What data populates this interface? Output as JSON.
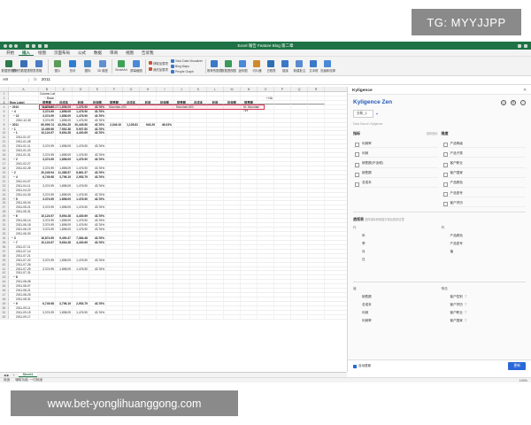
{
  "watermark_top": "TG: MYYJJPP",
  "watermark_bottom": "www.bet-yonglihuanggong.com",
  "window_title": "Excel 報告 Feature Blog 第二章",
  "ribbon": {
    "tabs": [
      "开始",
      "插入",
      "绘图",
      "页面布局",
      "公式",
      "数据",
      "审阅",
      "视图",
      "告诉我"
    ],
    "active_tab": "插入",
    "buttons": [
      {
        "label": "数据透视表",
        "icon": "pivot-table-icon",
        "color": "#2c7a4b"
      },
      {
        "label": "推荐的数据透视表",
        "icon": "recommended-pivot-icon",
        "color": "#3a6fb5"
      },
      {
        "label": "表格",
        "icon": "table-icon",
        "color": "#4a7cc6"
      },
      {
        "label": "图片",
        "icon": "picture-icon",
        "color": "#5a9a5a"
      },
      {
        "label": "形状",
        "icon": "shapes-icon",
        "color": "#2f7dd1"
      },
      {
        "label": "图标",
        "icon": "icons-icon",
        "color": "#4b86c4"
      },
      {
        "label": "3D 模型",
        "icon": "3d-model-icon",
        "color": "#5f8fd0"
      },
      {
        "label": "SmartArt",
        "icon": "smartart-icon",
        "color": "#3fa15a"
      },
      {
        "label": "屏幕截图",
        "icon": "screenshot-icon",
        "color": "#4a88d8"
      }
    ],
    "small_buttons": [
      "获取加载项",
      "我的加载项"
    ],
    "addin_buttons": [
      "Visio Data Visualizer",
      "Bing Maps",
      "People Graph"
    ],
    "right_buttons": [
      "推荐的图表",
      "数据透视图",
      "迷你图",
      "切片器",
      "日程表",
      "链接",
      "新建批注",
      "文本框",
      "页眉和页脚",
      "艺术字",
      "符号",
      "公式"
    ]
  },
  "formula_bar": {
    "cell": "A9",
    "fx": "fx",
    "value": "2011"
  },
  "columns": [
    "A",
    "B",
    "C",
    "D",
    "E",
    "F",
    "G",
    "H",
    "I",
    "J",
    "K",
    "L",
    "M",
    "N",
    "O",
    "P",
    "Q",
    "R"
  ],
  "pivot_header": {
    "row1": "Column Label",
    "row2": "− Black",
    "row3_labels": [
      "Mountain-100",
      "Mountain-200",
      "Mountain-500",
      "HL Mountain Tire"
    ],
    "na": "+ NA",
    "measures": [
      "销售额",
      "总成本",
      "利润",
      "利润率",
      "销售额",
      "总成本",
      "利润",
      "利润率",
      "销售额",
      "总成本",
      "利润",
      "利润率",
      "销售额"
    ]
  },
  "rows": [
    {
      "n": "1",
      "a": "",
      "v": []
    },
    {
      "n": "2",
      "a": "",
      "v": []
    },
    {
      "n": "3",
      "a": "Row Label",
      "v": [],
      "head": true
    },
    {
      "n": "4",
      "a": "− 2010",
      "v": [
        "3,374.99",
        "1,898.09",
        "1,476.90",
        "43.76%"
      ],
      "bold": true,
      "lvl": 0
    },
    {
      "n": "5",
      "a": "− 4",
      "v": [
        "3,374.99",
        "1,898.09",
        "1,476.90",
        "43.76%"
      ],
      "bold": true,
      "lvl": 1
    },
    {
      "n": "6",
      "a": "− 12",
      "v": [
        "3,374.99",
        "1,898.09",
        "1,476.90",
        "43.76%"
      ],
      "bold": true,
      "lvl": 2
    },
    {
      "n": "7",
      "a": "2010-12-30",
      "v": [
        "3,374.99",
        "1,898.09",
        "1,476.90",
        "43.76%"
      ],
      "lvl": 3
    },
    {
      "n": "8",
      "a": "− 2011",
      "v": [
        "60,999.74",
        "43,554.25",
        "20,445.50",
        "43.76%",
        "2,049.10",
        "1,105.81",
        "943.29",
        "46.03%"
      ],
      "bold": true,
      "lvl": 0
    },
    {
      "n": "9",
      "a": "− 1",
      "v": [
        "13,499.96",
        "7,592.36",
        "5,907.60",
        "43.76%"
      ],
      "bold": true,
      "lvl": 1
    },
    {
      "n": "10",
      "a": "− 1",
      "v": [
        "10,124.97",
        "5,694.28",
        "4,430.69",
        "43.76%"
      ],
      "bold": true,
      "lvl": 2
    },
    {
      "n": "11",
      "a": "2011-01-07",
      "v": [],
      "lvl": 3
    },
    {
      "n": "12",
      "a": "2011-01-08",
      "v": [],
      "lvl": 3
    },
    {
      "n": "13",
      "a": "2011-01-11",
      "v": [
        "3,374.99",
        "1,898.09",
        "1,476.90",
        "43.76%"
      ],
      "lvl": 3
    },
    {
      "n": "14",
      "a": "2011-01-20",
      "v": [],
      "lvl": 3
    },
    {
      "n": "15",
      "a": "2011-01-31",
      "v": [
        "3,374.99",
        "1,898.09",
        "1,476.90",
        "43.76%"
      ],
      "lvl": 3
    },
    {
      "n": "16",
      "a": "− 2",
      "v": [
        "3,374.99",
        "1,898.09",
        "1,476.90",
        "43.76%"
      ],
      "bold": true,
      "lvl": 2
    },
    {
      "n": "17",
      "a": "2011-02-27",
      "v": [],
      "lvl": 3
    },
    {
      "n": "18",
      "a": "2011-02-28",
      "v": [
        "3,374.99",
        "1,898.09",
        "1,476.90",
        "43.76%"
      ],
      "lvl": 3
    },
    {
      "n": "19",
      "a": "− 2",
      "v": [
        "20,249.94",
        "11,388.57",
        "8,861.37",
        "43.76%"
      ],
      "bold": true,
      "lvl": 1
    },
    {
      "n": "20",
      "a": "− 4",
      "v": [
        "6,749.98",
        "3,796.19",
        "2,953.79",
        "43.76%"
      ],
      "bold": true,
      "lvl": 2
    },
    {
      "n": "21",
      "a": "2011-04-07",
      "v": [],
      "lvl": 3
    },
    {
      "n": "22",
      "a": "2011-04-11",
      "v": [
        "3,374.99",
        "1,898.09",
        "1,476.90",
        "43.76%"
      ],
      "lvl": 3
    },
    {
      "n": "23",
      "a": "2011-04-22",
      "v": [],
      "lvl": 3
    },
    {
      "n": "24",
      "a": "2011-04-30",
      "v": [
        "3,374.99",
        "1,898.09",
        "1,476.90",
        "43.76%"
      ],
      "lvl": 3
    },
    {
      "n": "25",
      "a": "− 5",
      "v": [
        "3,374.99",
        "1,898.09",
        "1,476.90",
        "43.76%"
      ],
      "bold": true,
      "lvl": 2
    },
    {
      "n": "26",
      "a": "2011-05-04",
      "v": [],
      "lvl": 3
    },
    {
      "n": "27",
      "a": "2011-05-21",
      "v": [
        "3,374.99",
        "1,898.09",
        "1,476.90",
        "43.76%"
      ],
      "lvl": 3
    },
    {
      "n": "28",
      "a": "2011-05-31",
      "v": [],
      "lvl": 3
    },
    {
      "n": "29",
      "a": "− 6",
      "v": [
        "10,124.97",
        "5,694.28",
        "4,430.69",
        "43.76%"
      ],
      "bold": true,
      "lvl": 2
    },
    {
      "n": "30",
      "a": "2011-06-14",
      "v": [
        "3,374.99",
        "1,898.09",
        "1,476.90",
        "43.76%"
      ],
      "lvl": 3
    },
    {
      "n": "31",
      "a": "2011-06-18",
      "v": [
        "3,374.99",
        "1,898.09",
        "1,476.90",
        "43.76%"
      ],
      "lvl": 3
    },
    {
      "n": "32",
      "a": "2011-06-19",
      "v": [
        "3,374.99",
        "1,898.09",
        "1,476.90",
        "43.76%"
      ],
      "lvl": 3
    },
    {
      "n": "33",
      "a": "2011-06-30",
      "v": [],
      "lvl": 3
    },
    {
      "n": "34",
      "a": "− 3",
      "v": [
        "16,874.95",
        "9,490.47",
        "7,384.48",
        "43.76%"
      ],
      "bold": true,
      "lvl": 1
    },
    {
      "n": "35",
      "a": "− 7",
      "v": [
        "10,124.97",
        "5,694.28",
        "4,430.69",
        "43.76%"
      ],
      "bold": true,
      "lvl": 2
    },
    {
      "n": "36",
      "a": "2011-07-11",
      "v": [],
      "lvl": 3
    },
    {
      "n": "37",
      "a": "2011-07-14",
      "v": [],
      "lvl": 3
    },
    {
      "n": "38",
      "a": "2011-07-21",
      "v": [],
      "lvl": 3
    },
    {
      "n": "39",
      "a": "2011-07-22",
      "v": [
        "3,374.99",
        "1,898.09",
        "1,476.90",
        "43.76%"
      ],
      "lvl": 3
    },
    {
      "n": "40",
      "a": "2011-07-26",
      "v": [],
      "lvl": 3
    },
    {
      "n": "41",
      "a": "2011-07-29",
      "v": [
        "3,374.99",
        "1,898.09",
        "1,476.90",
        "43.76%"
      ],
      "lvl": 3
    },
    {
      "n": "42",
      "a": "2011-07-31",
      "v": [],
      "lvl": 3
    },
    {
      "n": "43",
      "a": "− 8",
      "v": [],
      "bold": true,
      "lvl": 2
    },
    {
      "n": "44",
      "a": "2011-08-08",
      "v": [],
      "lvl": 3
    },
    {
      "n": "45",
      "a": "2011-08-07",
      "v": [],
      "lvl": 3
    },
    {
      "n": "46",
      "a": "2011-08-21",
      "v": [],
      "lvl": 3
    },
    {
      "n": "47",
      "a": "2011-08-25",
      "v": [],
      "lvl": 3
    },
    {
      "n": "48",
      "a": "2011-08-31",
      "v": [],
      "lvl": 3
    },
    {
      "n": "49",
      "a": "− 9",
      "v": [
        "6,749.98",
        "3,796.19",
        "2,953.79",
        "43.76%"
      ],
      "bold": true,
      "lvl": 2
    },
    {
      "n": "50",
      "a": "2011-09-11",
      "v": [],
      "lvl": 3
    },
    {
      "n": "51",
      "a": "2011-09-15",
      "v": [
        "3,374.99",
        "1,898.09",
        "1,476.90",
        "43.76%"
      ],
      "lvl": 3
    },
    {
      "n": "52",
      "a": "2011-09-17",
      "v": [],
      "lvl": 3
    }
  ],
  "sheet_tabs": {
    "add": "+",
    "nav": "◀ ▶",
    "active": "Sheet1"
  },
  "statusbar": {
    "left": [
      "就绪",
      "辅助功能: 一切就绪"
    ],
    "zoom": "100%"
  },
  "panel": {
    "title": "Kyligence",
    "close": "✕",
    "brand": "Kyligence Zen",
    "icons": [
      "◎",
      "☰",
      "i"
    ],
    "analysis_tab": "分析_1",
    "add": "+",
    "subtitle": "Data Source: Kyligence",
    "metrics_title": "指标",
    "metrics_hint": "· 选择指标",
    "dimensions_title": "维度",
    "metrics": [
      "利润率",
      "利润",
      "销售额(不含税)",
      "销售额",
      "总成本"
    ],
    "dimensions": [
      "产品等级",
      "产品子类",
      "客户职业",
      "客户国家",
      "产品颜色",
      "产品型号",
      "客户学历"
    ],
    "pivot_title": "透视表",
    "pivot_hint": "选择指标和维度字段后拖到这里",
    "rows_label": "行",
    "cols_label": "列",
    "rows": [
      "年",
      "季",
      "月",
      "日"
    ],
    "cols": [
      "产品颜色",
      "产品型号",
      "值"
    ],
    "values_label": "值",
    "filters_label": "筛选",
    "values": [
      "销售额",
      "总成本",
      "利润",
      "利润率"
    ],
    "filters": [
      "客户性别",
      "客户学历",
      "客户职业",
      "客户国家"
    ],
    "auto_update": "自动更新",
    "update_btn": "更新"
  }
}
